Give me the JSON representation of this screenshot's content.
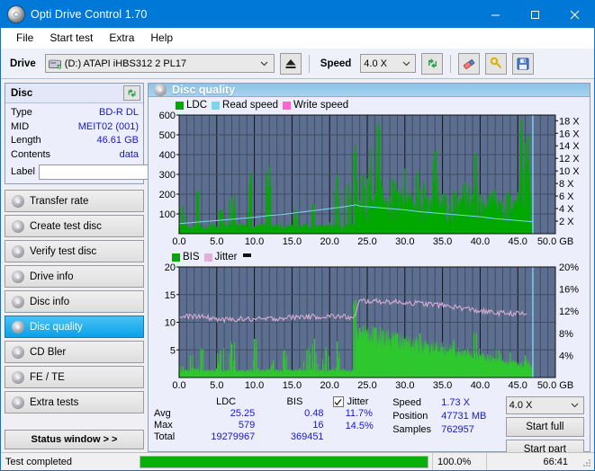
{
  "window": {
    "title": "Opti Drive Control 1.70",
    "app_icon": "disc-icon",
    "minimize": "–",
    "maximize": "□",
    "close": "✕"
  },
  "menu": [
    {
      "label": "File"
    },
    {
      "label": "Start test"
    },
    {
      "label": "Extra"
    },
    {
      "label": "Help"
    }
  ],
  "toolbar": {
    "drive_label": "Drive",
    "drive_value": "(D:)  ATAPI iHBS312  2 PL17",
    "eject_icon": "eject-icon",
    "speed_label": "Speed",
    "speed_value": "4.0 X",
    "refresh_icon": "refresh-icon",
    "eraser_icon": "eraser-icon",
    "key_icon": "key-icon",
    "save_icon": "save-icon"
  },
  "sidebar": {
    "disc_panel": {
      "title": "Disc",
      "refresh_icon": "refresh-icon",
      "rows": [
        {
          "key": "Type",
          "value": "BD-R DL"
        },
        {
          "key": "MID",
          "value": "MEIT02 (001)"
        },
        {
          "key": "Length",
          "value": "46.61 GB"
        },
        {
          "key": "Contents",
          "value": "data"
        }
      ],
      "label_key": "Label",
      "label_value": "",
      "label_placeholder": "",
      "label_button_icon": "disc-icon"
    },
    "nav": [
      {
        "label": "Transfer rate",
        "icon": "disc-test-icon",
        "active": false
      },
      {
        "label": "Create test disc",
        "icon": "disc-burn-icon",
        "active": false
      },
      {
        "label": "Verify test disc",
        "icon": "disc-verify-icon",
        "active": false
      },
      {
        "label": "Drive info",
        "icon": "drive-info-icon",
        "active": false
      },
      {
        "label": "Disc info",
        "icon": "disc-info-icon",
        "active": false
      },
      {
        "label": "Disc quality",
        "icon": "disc-quality-icon",
        "active": true
      },
      {
        "label": "CD Bler",
        "icon": "cd-bler-icon",
        "active": false
      },
      {
        "label": "FE / TE",
        "icon": "fe-te-icon",
        "active": false
      },
      {
        "label": "Extra tests",
        "icon": "extra-tests-icon",
        "active": false
      }
    ],
    "status_window": "Status window > >"
  },
  "main": {
    "header": "Disc quality",
    "header_icon": "disc-quality-icon",
    "stats": {
      "col_headers": [
        "LDC",
        "BIS"
      ],
      "rows": [
        {
          "label": "Avg",
          "ldc": "25.25",
          "bis": "0.48"
        },
        {
          "label": "Max",
          "ldc": "579",
          "bis": "16"
        },
        {
          "label": "Total",
          "ldc": "19279967",
          "bis": "369451"
        }
      ],
      "jitter_label": "Jitter",
      "jitter_checked": true,
      "jitter_avg": "11.7%",
      "jitter_max": "14.5%",
      "speed_key": "Speed",
      "speed_value": "1.73 X",
      "position_key": "Position",
      "position_value": "47731 MB",
      "samples_key": "Samples",
      "samples_value": "762957",
      "speed_select": "4.0 X",
      "start_full": "Start full",
      "start_part": "Start part"
    }
  },
  "statusbar": {
    "text": "Test completed",
    "progress_percent": 100.0,
    "progress_label": "100.0%",
    "elapsed": "66:41"
  },
  "colors": {
    "accent": "#0078d7",
    "ldc_green": "#00a800",
    "bis_green": "#2ec82e",
    "read_speed": "#7fd4f2",
    "write_speed": "#ff66cc",
    "jitter_pink": "#e0b0d8",
    "plot_bg": "#5d6f90",
    "value_blue": "#1818c8"
  },
  "chart_data": [
    {
      "type": "area",
      "name": "ldc-chart",
      "title": "",
      "xlabel": "GB",
      "ylabel": "",
      "xlim": [
        0,
        50
      ],
      "ylim": [
        0,
        600
      ],
      "y2lim": [
        0,
        18
      ],
      "y2label": "X",
      "xticks": [
        "0.0",
        "5.0",
        "10.0",
        "15.0",
        "20.0",
        "25.0",
        "30.0",
        "35.0",
        "40.0",
        "45.0",
        "50.0 GB"
      ],
      "yticks": [
        100,
        200,
        300,
        400,
        500,
        600
      ],
      "y2ticks": [
        "2 X",
        "4 X",
        "6 X",
        "8 X",
        "10 X",
        "12 X",
        "14 X",
        "16 X",
        "18 X"
      ],
      "grid": true,
      "legend": [
        {
          "label": "LDC",
          "color": "#00a800"
        },
        {
          "label": "Read speed",
          "color": "#7fd4f2"
        },
        {
          "label": "Write speed",
          "color": "#ff66cc"
        }
      ],
      "series": [
        {
          "name": "LDC",
          "color": "#00a800",
          "kind": "impulse",
          "note": "baseline ~20-40 until 23.5GB, then elevated 120-200 with spikes to 579 near 46GB; data ends at 47.0GB",
          "x": [
            0.0,
            0.5,
            1.0,
            1.5,
            2.0,
            2.5,
            3.0,
            3.5,
            4.0,
            4.5,
            5.0,
            5.5,
            6.0,
            6.5,
            7.0,
            7.5,
            8.0,
            8.5,
            9.0,
            9.5,
            10.0,
            10.5,
            11.0,
            11.5,
            12.0,
            12.5,
            13.0,
            13.5,
            14.0,
            14.5,
            15.0,
            15.5,
            16.0,
            16.5,
            17.0,
            17.5,
            18.0,
            18.5,
            19.0,
            19.5,
            20.0,
            20.5,
            21.0,
            21.5,
            22.0,
            22.5,
            23.0,
            23.5,
            24.0,
            24.5,
            25.0,
            25.5,
            26.0,
            26.5,
            27.0,
            27.5,
            28.0,
            28.5,
            29.0,
            29.5,
            30.0,
            30.5,
            31.0,
            31.5,
            32.0,
            32.5,
            33.0,
            33.5,
            34.0,
            34.5,
            35.0,
            35.5,
            36.0,
            36.5,
            37.0,
            37.5,
            38.0,
            38.5,
            39.0,
            39.5,
            40.0,
            40.5,
            41.0,
            41.5,
            42.0,
            42.5,
            43.0,
            43.5,
            44.0,
            44.5,
            45.0,
            45.5,
            46.0,
            46.5,
            47.0
          ],
          "y": [
            30,
            140,
            45,
            35,
            40,
            210,
            30,
            38,
            55,
            42,
            30,
            120,
            60,
            38,
            180,
            44,
            52,
            34,
            30,
            290,
            35,
            40,
            48,
            60,
            340,
            38,
            42,
            55,
            36,
            30,
            44,
            120,
            38,
            52,
            44,
            30,
            150,
            48,
            34,
            42,
            58,
            36,
            300,
            40,
            44,
            250,
            50,
            410,
            170,
            300,
            280,
            430,
            200,
            560,
            240,
            180,
            190,
            260,
            220,
            200,
            330,
            180,
            150,
            300,
            220,
            250,
            190,
            170,
            420,
            160,
            200,
            180,
            150,
            220,
            190,
            170,
            260,
            240,
            200,
            410,
            180,
            150,
            170,
            190,
            220,
            180,
            160,
            200,
            190,
            170,
            210,
            579,
            460,
            500,
            200
          ]
        },
        {
          "name": "Read speed",
          "color": "#7fd4f2",
          "kind": "line",
          "note": "stepped CAV-like curve rising 1.6X to 4.6X then falling back to ~1.7X after 24GB",
          "x": [
            0,
            2,
            4,
            6,
            8,
            10,
            12,
            14,
            16,
            18,
            20,
            22,
            23.5,
            24,
            26,
            28,
            30,
            32,
            34,
            36,
            38,
            40,
            42,
            44,
            46,
            47
          ],
          "y": [
            1.6,
            1.8,
            2.0,
            2.2,
            2.4,
            2.6,
            2.9,
            3.1,
            3.4,
            3.7,
            4.0,
            4.3,
            4.6,
            4.4,
            4.2,
            4.0,
            3.8,
            3.5,
            3.3,
            3.1,
            2.9,
            2.7,
            2.4,
            2.2,
            2.0,
            1.9
          ]
        },
        {
          "name": "Write speed",
          "color": "#ff66cc",
          "kind": "line",
          "x": [],
          "y": []
        }
      ],
      "markers": [
        {
          "name": "end-of-data-cursor",
          "x": 47.0,
          "color": "#7fd4f2"
        }
      ]
    },
    {
      "type": "area",
      "name": "bis-jitter-chart",
      "title": "",
      "xlabel": "GB",
      "ylabel": "",
      "xlim": [
        0,
        50
      ],
      "ylim": [
        0,
        20
      ],
      "y2lim": [
        0,
        20
      ],
      "y2label": "%",
      "xticks": [
        "0.0",
        "5.0",
        "10.0",
        "15.0",
        "20.0",
        "25.0",
        "30.0",
        "35.0",
        "40.0",
        "45.0",
        "50.0 GB"
      ],
      "yticks": [
        5,
        10,
        15,
        20
      ],
      "y2ticks": [
        "4%",
        "8%",
        "12%",
        "16%",
        "20%"
      ],
      "grid": true,
      "legend": [
        {
          "label": "BIS",
          "color": "#00a800"
        },
        {
          "label": "Jitter",
          "color": "#e0b0d8"
        }
      ],
      "series": [
        {
          "name": "BIS",
          "color": "#2ec82e",
          "kind": "impulse",
          "note": "baseline ~1 until 23.5GB with occasional spikes to 7; then 4-9 band decaying to ~2 by 45GB; ends 47.0GB",
          "x": [
            0.0,
            0.5,
            1.0,
            1.5,
            2.0,
            2.5,
            3.0,
            3.5,
            4.0,
            4.5,
            5.0,
            5.5,
            6.0,
            6.5,
            7.0,
            7.5,
            8.0,
            8.5,
            9.0,
            9.5,
            10.0,
            10.5,
            11.0,
            11.5,
            12.0,
            12.5,
            13.0,
            13.5,
            14.0,
            14.5,
            15.0,
            15.5,
            16.0,
            16.5,
            17.0,
            17.5,
            18.0,
            18.5,
            19.0,
            19.5,
            20.0,
            20.5,
            21.0,
            21.5,
            22.0,
            22.5,
            23.0,
            23.5,
            24.0,
            24.5,
            25.0,
            25.5,
            26.0,
            26.5,
            27.0,
            27.5,
            28.0,
            28.5,
            29.0,
            29.5,
            30.0,
            30.5,
            31.0,
            31.5,
            32.0,
            32.5,
            33.0,
            33.5,
            34.0,
            34.5,
            35.0,
            35.5,
            36.0,
            36.5,
            37.0,
            37.5,
            38.0,
            38.5,
            39.0,
            39.5,
            40.0,
            40.5,
            41.0,
            41.5,
            42.0,
            42.5,
            43.0,
            43.5,
            44.0,
            44.5,
            45.0,
            45.5,
            46.0,
            46.5,
            47.0
          ],
          "y": [
            1.2,
            2.0,
            1.3,
            4.0,
            1.2,
            1.5,
            5.0,
            1.3,
            1.4,
            1.2,
            1.6,
            5.0,
            1.4,
            1.3,
            6.0,
            1.5,
            1.3,
            1.2,
            1.4,
            1.5,
            7.0,
            1.6,
            1.4,
            1.3,
            1.5,
            3.0,
            1.4,
            1.3,
            5.0,
            1.5,
            1.3,
            1.4,
            1.6,
            1.3,
            5.0,
            1.5,
            7.0,
            1.4,
            1.3,
            5.5,
            1.4,
            1.3,
            6.5,
            1.4,
            1.5,
            1.3,
            1.4,
            14.0,
            9.0,
            7.5,
            8.0,
            6.0,
            9.0,
            5.5,
            8.5,
            6.0,
            7.0,
            6.5,
            8.0,
            5.5,
            7.0,
            6.0,
            5.5,
            6.5,
            8.0,
            5.0,
            6.0,
            5.5,
            5.0,
            4.5,
            5.5,
            4.0,
            5.0,
            6.5,
            4.5,
            4.0,
            5.0,
            4.5,
            3.5,
            8.0,
            4.0,
            3.5,
            4.0,
            3.0,
            3.5,
            5.0,
            3.0,
            2.5,
            4.5,
            3.0,
            2.5,
            2.8,
            4.0,
            3.0,
            2.5
          ]
        },
        {
          "name": "Jitter",
          "color": "#e0b0d8",
          "kind": "line",
          "note": "noisy band ~10.5-11.5% until 23.5GB, jumps to ~13.5-14%, decays to ~11.5% at 46GB; max 14.5%",
          "x": [
            0,
            2,
            4,
            6,
            8,
            10,
            12,
            14,
            16,
            18,
            20,
            22,
            23.3,
            24,
            26,
            28,
            30,
            32,
            34,
            36,
            38,
            40,
            42,
            44,
            46
          ],
          "y": [
            10.9,
            11.1,
            10.8,
            10.4,
            10.6,
            10.5,
            10.6,
            10.8,
            11.0,
            11.0,
            11.1,
            11.0,
            10.7,
            13.9,
            13.8,
            13.7,
            13.6,
            13.4,
            13.2,
            12.9,
            12.5,
            12.0,
            11.7,
            11.6,
            11.5
          ]
        }
      ],
      "markers": [
        {
          "name": "end-of-data-cursor",
          "x": 47.0,
          "color": "#7fd4f2"
        }
      ]
    }
  ]
}
